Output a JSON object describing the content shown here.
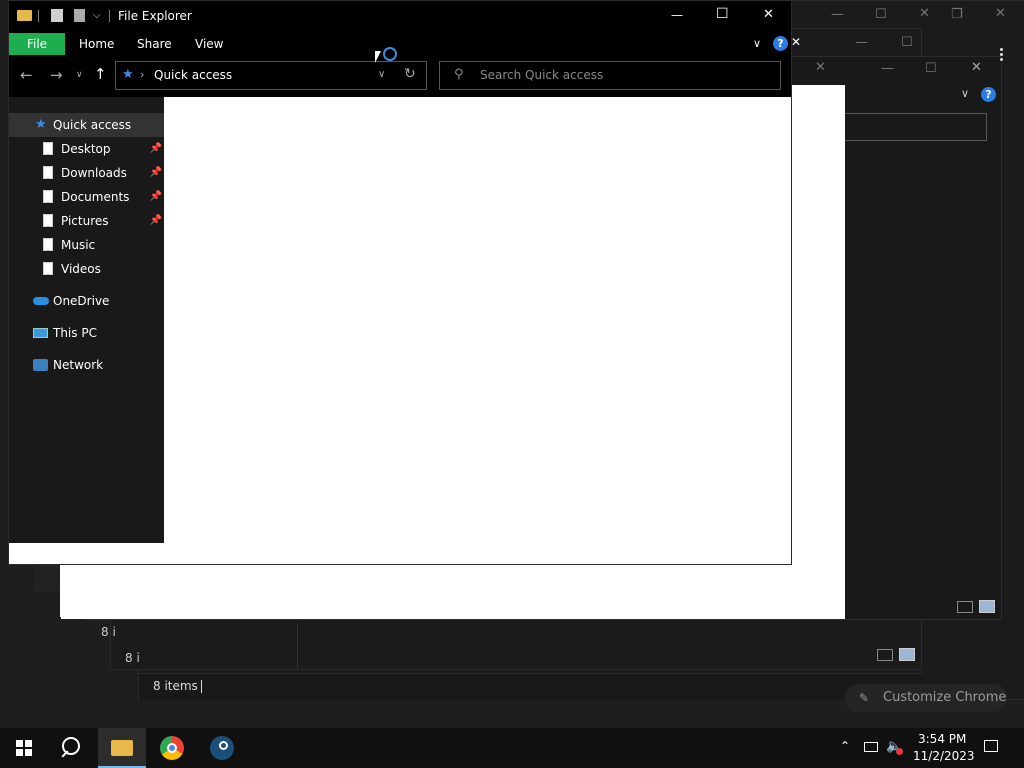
{
  "window": {
    "title": "File Explorer",
    "controls": {
      "minimize": "—",
      "maximize": "☐",
      "close": "✕"
    }
  },
  "ribbon": {
    "tabs": [
      {
        "label": "File",
        "active": true
      },
      {
        "label": "Home"
      },
      {
        "label": "Share"
      },
      {
        "label": "View"
      }
    ],
    "help": "?"
  },
  "address_bar": {
    "path": "Quick access",
    "search_placeholder": "Search Quick access"
  },
  "nav_pane": {
    "quick_access": "Quick access",
    "pinned": [
      {
        "label": "Desktop",
        "pinned": true
      },
      {
        "label": "Downloads",
        "pinned": true
      },
      {
        "label": "Documents",
        "pinned": true
      },
      {
        "label": "Pictures",
        "pinned": true
      },
      {
        "label": "Music",
        "pinned": false
      },
      {
        "label": "Videos",
        "pinned": false
      }
    ],
    "onedrive": "OneDrive",
    "this_pc": "This PC",
    "network": "Network"
  },
  "background_windows": {
    "status_items": "8 items",
    "status_partial_1": "8 i",
    "status_partial_2": "8 i",
    "customize_chrome": "Customize Chrome"
  },
  "taskbar": {
    "time": "3:54 PM",
    "date": "11/2/2023",
    "apps": [
      "windows-start",
      "search",
      "file-explorer",
      "chrome",
      "steam"
    ]
  },
  "colors": {
    "file_tab": "#1fae4f",
    "accent": "#76b9ed",
    "help_badge": "#2d7be5"
  }
}
